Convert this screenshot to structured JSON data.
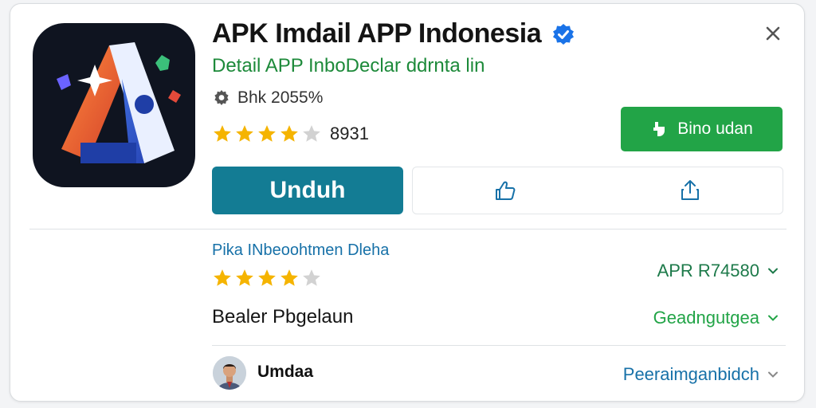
{
  "app": {
    "title": "APK Imdail APP Indonesia",
    "subtitle": "Detail APP InboDeclar ddrnta lin",
    "meta": "Bhk 2055%",
    "rating_value": 4,
    "rating_max": 5,
    "rating_count": "8931"
  },
  "buttons": {
    "secondary_label": "Bino udan",
    "primary_label": "Unduh"
  },
  "details": {
    "section_label": "Pika INbeoohtmen Dleha",
    "rating_value": 4,
    "rating_max": 5,
    "version_text": "APR R74580",
    "row2_label": "Bealer Pbgelaun",
    "row2_value": "Geadngutgea",
    "user_name": "Umdaa",
    "user_link": "Peeraimganbidch"
  },
  "colors": {
    "primary": "#137c94",
    "green": "#22a447",
    "link_blue": "#1771a8",
    "star": "#f5b400",
    "star_empty": "#d2d2d2"
  }
}
